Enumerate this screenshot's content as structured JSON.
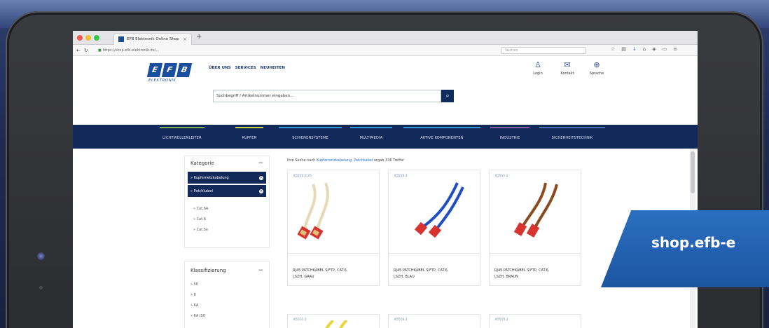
{
  "browser": {
    "tab_title": "EFB Elektronik Online Shop",
    "url": "https://shop.efb-elektronik.de/...",
    "search_placeholder": "Suchen"
  },
  "header": {
    "logo_letters": [
      "E",
      "F",
      "B"
    ],
    "logo_sub": "ELEKTRONIK",
    "nav": [
      "ÜBER UNS",
      "SERVICES",
      "NEUHEITEN"
    ],
    "user_links": [
      {
        "label": "Login",
        "icon": "user-icon"
      },
      {
        "label": "Kontakt",
        "icon": "mail-icon"
      },
      {
        "label": "Sprache",
        "icon": "globe-icon"
      }
    ],
    "search_placeholder": "Suchbegriff / Artikelnummer eingeben..."
  },
  "category_bar": {
    "items": [
      {
        "label": "LICHTWELLENLEITER",
        "accent": "#7bb543"
      },
      {
        "label": "KUPFER",
        "accent": "#c7d43a"
      },
      {
        "label": "SCHIENENSYSTEME",
        "accent": "#2c9ad6"
      },
      {
        "label": "MULTIMEDIA",
        "accent": "#2c9ad6"
      },
      {
        "label": "AKTIVE KOMPONENTEN",
        "accent": "#2c9ad6"
      },
      {
        "label": "INDUSTRIE",
        "accent": "#8a5aa8"
      },
      {
        "label": "SICHERHEITSTECHNIK",
        "accent": "#4a6fb3"
      }
    ]
  },
  "sidebar": {
    "kategorie_title": "Kategorie",
    "active_categories": [
      "» Kupfernetzkabelung",
      "» Patchkabel"
    ],
    "sub_items": [
      "» Cat.6A",
      "» Cat.6",
      "» Cat.5e"
    ],
    "klassifizierung_title": "Klassifizierung",
    "class_items": [
      "» 5E",
      "» 6",
      "» 6A",
      "» 6A ISO"
    ]
  },
  "results": {
    "prefix": "Ihre Suche nach",
    "terms": "Kupfernetzkabelung, Patchkabel",
    "suffix": "ergab 336 Treffer",
    "products": [
      {
        "sku": "K5510.0,25",
        "name_1": "RJ45 PATCHKABEL S/FTP, CAT.6,",
        "name_2": "LSZH, GRAU",
        "cable": "#e8d9b5"
      },
      {
        "sku": "K5510.2",
        "name_1": "RJ45 PATCHKABEL S/FTP, CAT.6,",
        "name_2": "LSZH, BLAU",
        "cable": "#1f4fc2"
      },
      {
        "sku": "K5511.2",
        "name_1": "RJ45 PATCHKABEL S/FTP, CAT.6,",
        "name_2": "LSZH, BRAUN",
        "cable": "#8a4a1f"
      }
    ],
    "row2_skus": [
      "K5511.2",
      "K5514.2",
      "K5515.2"
    ]
  },
  "banner": {
    "text": "shop.efb-e"
  },
  "colors": {
    "brand_blue": "#1a4fa0",
    "nav_dark": "#12295a",
    "link_blue": "#2a6ad8"
  }
}
